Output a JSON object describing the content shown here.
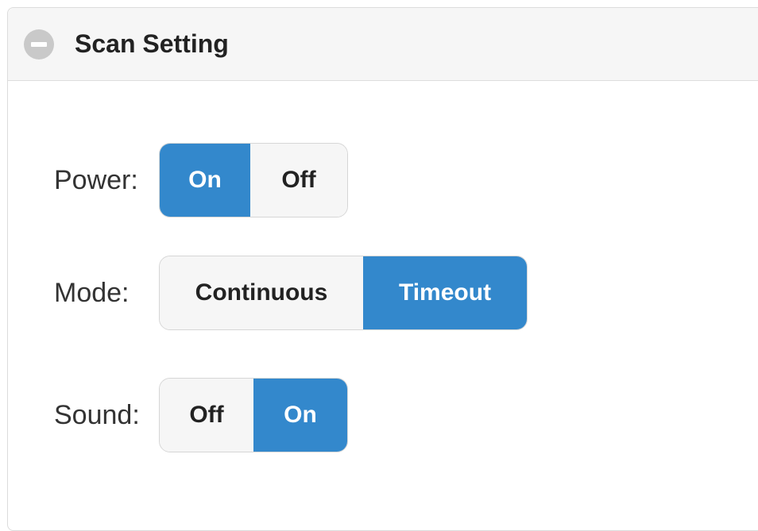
{
  "panel": {
    "title": "Scan Setting",
    "collapse_icon": "minus-circle-icon"
  },
  "settings": {
    "power": {
      "label": "Power:",
      "options": [
        "On",
        "Off"
      ],
      "selected": "On"
    },
    "mode": {
      "label": "Mode:",
      "options": [
        "Continuous",
        "Timeout"
      ],
      "selected": "Timeout"
    },
    "sound": {
      "label": "Sound:",
      "options": [
        "Off",
        "On"
      ],
      "selected": "On"
    }
  },
  "colors": {
    "active": "#3388cc",
    "inactive": "#f6f6f6",
    "header_bg": "#f6f6f6"
  }
}
